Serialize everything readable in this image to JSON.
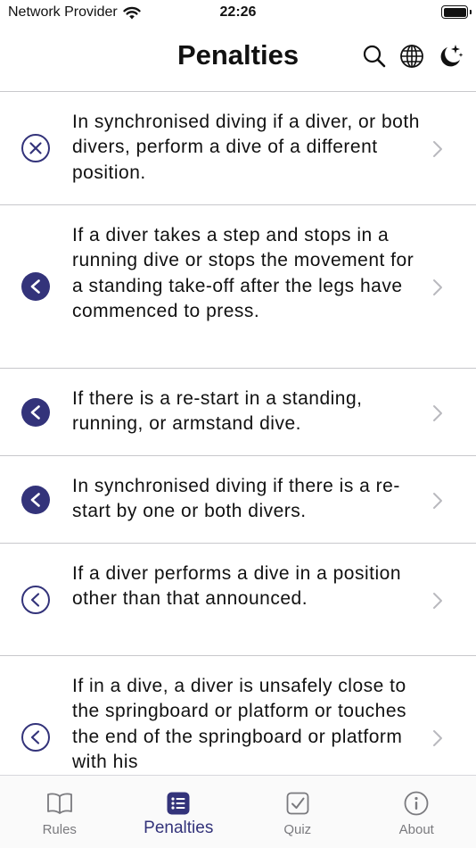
{
  "status_bar": {
    "carrier": "Network Provider",
    "time": "22:26",
    "icons": [
      "wifi-icon",
      "battery-icon"
    ]
  },
  "header": {
    "title": "Penalties",
    "actions": [
      "search-icon",
      "globe-icon",
      "moon-stars-icon"
    ]
  },
  "penalties": [
    {
      "icon": "x-circle-icon",
      "text": "In synchronised diving if a diver, or both divers, perform a dive of a different position."
    },
    {
      "icon": "chevron-left-filled-circle-icon",
      "text": "If a diver takes a step and stops in a running dive or stops the movement for a standing take-off after the legs have commenced to press."
    },
    {
      "icon": "chevron-left-filled-circle-icon",
      "text": "If there is a re-start in a standing, running, or armstand dive."
    },
    {
      "icon": "chevron-left-filled-circle-icon",
      "text": "In synchronised diving if there is a re-start by one or both divers."
    },
    {
      "icon": "chevron-left-circle-icon",
      "text": "If a diver performs a dive in a position other than that announced."
    },
    {
      "icon": "chevron-left-circle-icon",
      "text": "If in a dive, a diver is unsafely close to the springboard or platform or touches the end of the springboard or platform with his"
    }
  ],
  "tabs": [
    {
      "label": "Rules",
      "icon": "book-icon",
      "active": false
    },
    {
      "label": "Penalties",
      "icon": "list-icon",
      "active": true
    },
    {
      "label": "Quiz",
      "icon": "checkbox-icon",
      "active": false
    },
    {
      "label": "About",
      "icon": "info-icon",
      "active": false
    }
  ],
  "colors": {
    "accent": "#33337a",
    "inactive": "#7a7a7e",
    "separator": "#c8c8cc",
    "chevron": "#b9b9be"
  }
}
